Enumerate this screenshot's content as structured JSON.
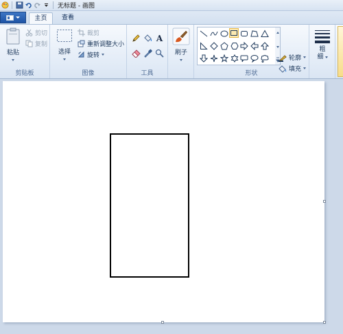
{
  "titlebar": {
    "quick_access": [
      "paint-app-icon",
      "save-icon",
      "undo-icon",
      "redo-icon",
      "customize-icon"
    ],
    "title": "无标题 - 画图"
  },
  "menu": {
    "app_menu_icon": "app-menu-icon"
  },
  "tabs": [
    {
      "label": "主页",
      "active": true
    },
    {
      "label": "查看",
      "active": false
    }
  ],
  "ribbon": {
    "clipboard": {
      "paste_label": "粘贴",
      "cut_label": "剪切",
      "copy_label": "复制",
      "group_label": "剪贴板"
    },
    "image": {
      "select_label": "选择",
      "crop_label": "裁剪",
      "resize_label": "重新调整大小",
      "rotate_label": "旋转",
      "group_label": "图像"
    },
    "tools": {
      "items": [
        "pencil-icon",
        "fill-bucket-icon",
        "text-icon",
        "eraser-icon",
        "color-picker-icon",
        "magnifier-icon"
      ],
      "text_glyph": "A",
      "group_label": "工具"
    },
    "brushes": {
      "label": "刷子"
    },
    "shapes": {
      "items": [
        "line",
        "curve",
        "oval",
        "rectangle",
        "rounded-rectangle",
        "polygon",
        "triangle",
        "right-triangle",
        "diamond",
        "pentagon",
        "hexagon",
        "arrow-right",
        "arrow-left",
        "arrow-up",
        "arrow-down",
        "star-four",
        "star-five",
        "star-six",
        "callout-rounded",
        "callout-oval",
        "callout-cloud",
        "heart",
        "lightning"
      ],
      "selected": "rectangle",
      "outline_label": "轮廓",
      "fill_label": "填充",
      "group_label": "形状"
    },
    "size": {
      "label_line1": "粗",
      "label_line2": "细"
    }
  },
  "canvas": {
    "background": "#ffffff",
    "shape_stroke": "#000000"
  }
}
